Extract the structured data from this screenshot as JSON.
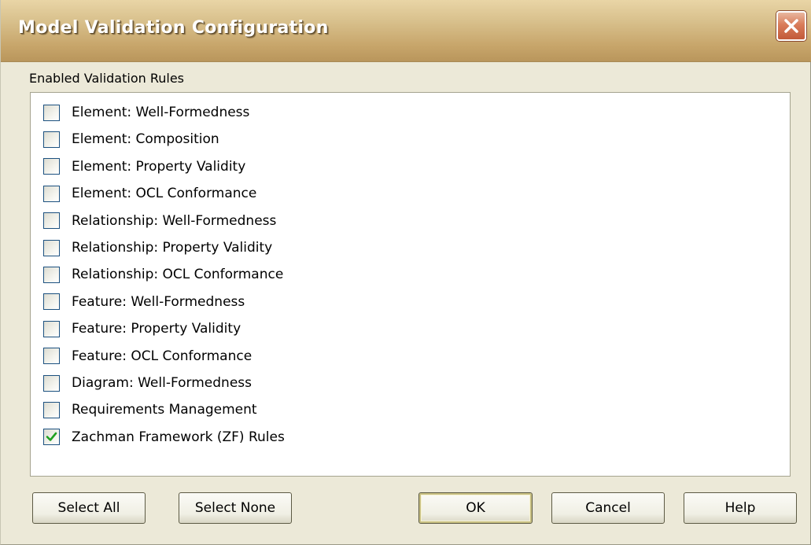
{
  "window": {
    "title": "Model Validation Configuration",
    "close_icon": "close-icon"
  },
  "group": {
    "label": "Enabled Validation Rules"
  },
  "rules": [
    {
      "label": "Element: Well-Formedness",
      "checked": false
    },
    {
      "label": "Element: Composition",
      "checked": false
    },
    {
      "label": "Element: Property Validity",
      "checked": false
    },
    {
      "label": "Element: OCL Conformance",
      "checked": false
    },
    {
      "label": "Relationship: Well-Formedness",
      "checked": false
    },
    {
      "label": "Relationship: Property Validity",
      "checked": false
    },
    {
      "label": "Relationship: OCL Conformance",
      "checked": false
    },
    {
      "label": "Feature: Well-Formedness",
      "checked": false
    },
    {
      "label": "Feature: Property Validity",
      "checked": false
    },
    {
      "label": "Feature: OCL Conformance",
      "checked": false
    },
    {
      "label": "Diagram: Well-Formedness",
      "checked": false
    },
    {
      "label": "Requirements Management",
      "checked": false
    },
    {
      "label": "Zachman Framework (ZF) Rules",
      "checked": true
    }
  ],
  "buttons": {
    "select_all": "Select All",
    "select_none": "Select None",
    "ok": "OK",
    "cancel": "Cancel",
    "help": "Help"
  },
  "colors": {
    "title_bar": "#c7a56a",
    "dialog_bg": "#ece9d8",
    "checkbox_border": "#1c5180",
    "checkmark": "#21a121"
  }
}
